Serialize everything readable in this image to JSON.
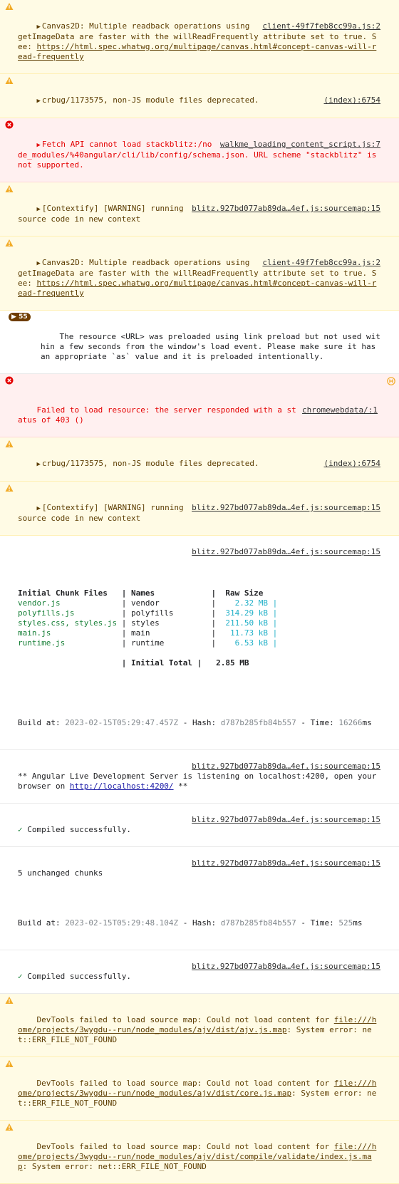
{
  "messages": [
    {
      "type": "warn",
      "arrow": true,
      "source": "client-49f7feb8cc99a.js:2",
      "text": "Canvas2D: Multiple readback operations using getImageData are faster with the willReadFrequently attribute set to true. See: ",
      "link": "https://html.spec.whatwg.org/multipage/canvas.html#concept-canvas-will-read-frequently"
    },
    {
      "type": "warn",
      "arrow": true,
      "source": "(index):6754",
      "text": "crbug/1173575, non-JS module files deprecated."
    },
    {
      "type": "error",
      "arrow": true,
      "source": "walkme_loading_content_script.js:7",
      "text": "Fetch API cannot load stackblitz:/node_modules/%40angular/cli/lib/config/schema.json. URL scheme \"stackblitz\" is not supported."
    },
    {
      "type": "warn",
      "arrow": true,
      "source": "blitz.927bd077ab89da…4ef.js:sourcemap:15",
      "text": "[Contextify] [WARNING] running source code in new context"
    },
    {
      "type": "warn",
      "arrow": true,
      "source": "client-49f7feb8cc99a.js:2",
      "text": "Canvas2D: Multiple readback operations using getImageData are faster with the willReadFrequently attribute set to true. See: ",
      "link": "https://html.spec.whatwg.org/multipage/canvas.html#concept-canvas-will-read-frequently"
    },
    {
      "type": "group",
      "count": "55",
      "text": "The resource <URL> was preloaded using link preload but not used within a few seconds from the window's load event. Please make sure it has an appropriate `as` value and it is preloaded intentionally."
    },
    {
      "type": "error",
      "arrow": false,
      "source": "chromewebdata/:1",
      "text": "Failed to load resource: the server responded with a status of 403 ()"
    },
    {
      "type": "warn",
      "arrow": true,
      "source": "(index):6754",
      "text": "crbug/1173575, non-JS module files deprecated."
    },
    {
      "type": "warn",
      "arrow": true,
      "source": "blitz.927bd077ab89da…4ef.js:sourcemap:15",
      "text": "[Contextify] [WARNING] running source code in new context"
    }
  ],
  "chunk_log": {
    "source": "blitz.927bd077ab89da…4ef.js:sourcemap:15",
    "headers": [
      "Initial Chunk Files",
      "Names",
      "Raw Size"
    ],
    "rows": [
      {
        "file": "vendor.js",
        "name": "vendor",
        "size": "2.32 MB"
      },
      {
        "file": "polyfills.js",
        "name": "polyfills",
        "size": "314.29 kB"
      },
      {
        "file": "styles.css, styles.js",
        "name": "styles",
        "size": "211.50 kB"
      },
      {
        "file": "main.js",
        "name": "main",
        "size": "11.73 kB"
      },
      {
        "file": "runtime.js",
        "name": "runtime",
        "size": "6.53 kB"
      }
    ],
    "total_label": "Initial Total",
    "total_size": "2.85 MB",
    "build_prefix": "Build at: ",
    "build_time": "2023-02-15T05:29:47.457Z",
    "hash_prefix": " - Hash: ",
    "hash": "d787b285fb84b557",
    "time_prefix": " - Time: ",
    "time": "16266",
    "time_unit": "ms"
  },
  "server_log": {
    "source": "blitz.927bd077ab89da…4ef.js:sourcemap:15",
    "text": "** Angular Live Development Server is listening on localhost:4200, open your browser on ",
    "link": "http://localhost:4200/",
    "suffix": " **"
  },
  "compiled1": {
    "source": "blitz.927bd077ab89da…4ef.js:sourcemap:15",
    "text": "Compiled successfully."
  },
  "unchanged": {
    "source": "blitz.927bd077ab89da…4ef.js:sourcemap:15",
    "text": "5 unchanged chunks",
    "build_prefix": "Build at: ",
    "build_time": "2023-02-15T05:29:48.104Z",
    "hash_prefix": " - Hash: ",
    "hash": "d787b285fb84b557",
    "time_prefix": " - Time: ",
    "time": "525",
    "time_unit": "ms"
  },
  "compiled2": {
    "source": "blitz.927bd077ab89da…4ef.js:sourcemap:15",
    "text": "Compiled successfully."
  },
  "devtools": [
    {
      "text": "DevTools failed to load source map: Could not load content for ",
      "link": "file:///home/projects/3wygdu--run/node_modules/ajv/dist/ajv.js.map",
      "suffix": ": System error: net::ERR_FILE_NOT_FOUND"
    },
    {
      "text": "DevTools failed to load source map: Could not load content for ",
      "link": "file:///home/projects/3wygdu--run/node_modules/ajv/dist/core.js.map",
      "suffix": ": System error: net::ERR_FILE_NOT_FOUND"
    },
    {
      "text": "DevTools failed to load source map: Could not load content for ",
      "link": "file:///home/projects/3wygdu--run/node_modules/ajv/dist/compile/validate/index.js.map",
      "suffix": ": System error: net::ERR_FILE_NOT_FOUND"
    }
  ],
  "colors": {
    "warn_bg": "#fffbe5",
    "error_bg": "#fff0f0",
    "warn_icon": "#f2ab26",
    "error_icon": "#e40000"
  }
}
